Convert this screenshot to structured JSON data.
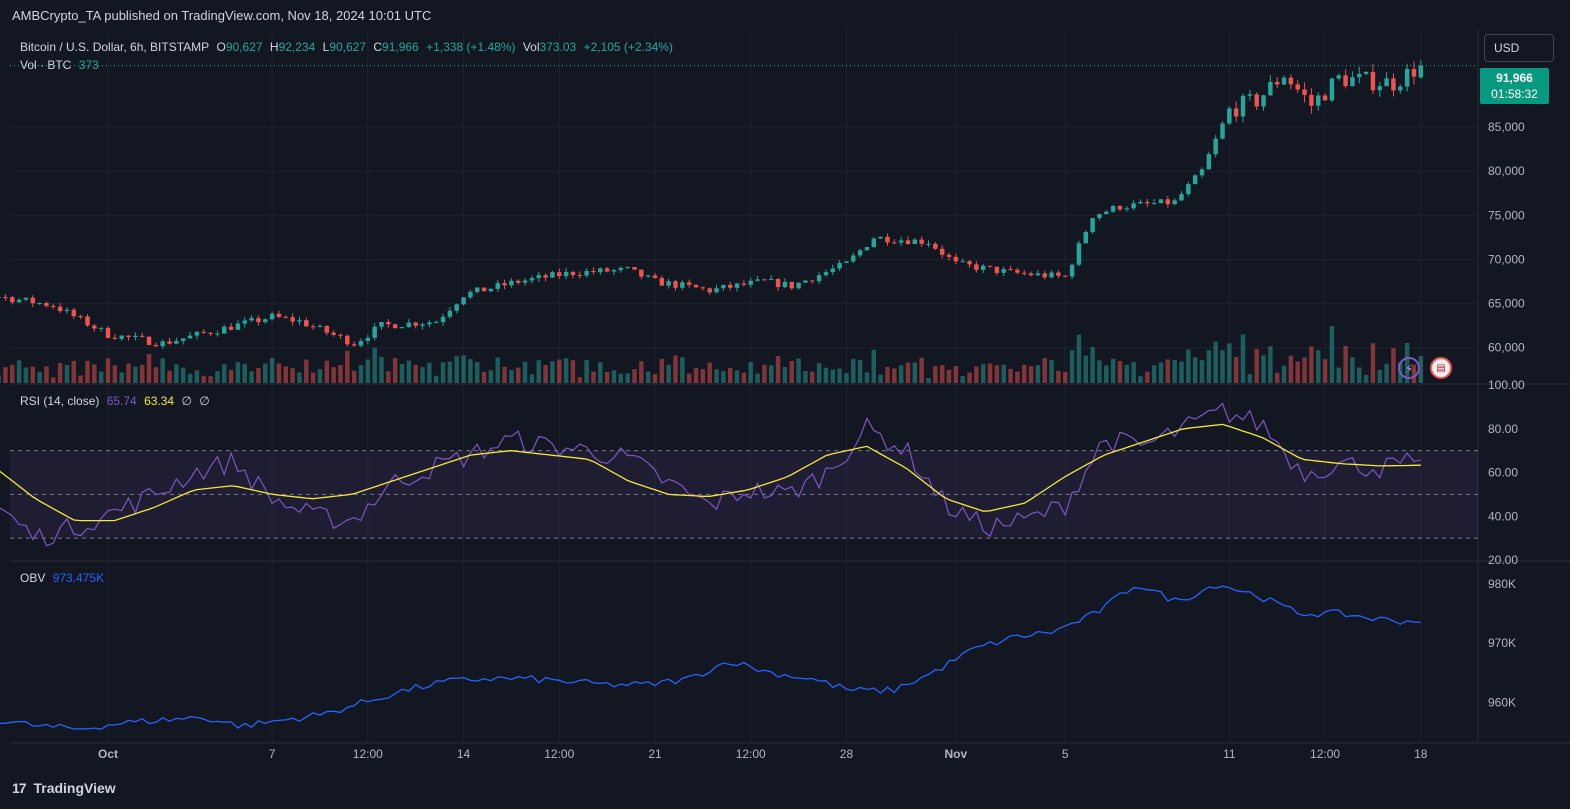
{
  "publisher": "AMBCrypto_TA published on TradingView.com, Nov 18, 2024 10:01 UTC",
  "legend": {
    "symbol": "Bitcoin / U.S. Dollar, 6h, BITSTAMP",
    "o_label": "O",
    "o": "90,627",
    "h_label": "H",
    "h": "92,234",
    "l_label": "L",
    "l": "90,627",
    "c_label": "C",
    "c": "91,966",
    "change": "+1,338 (+1.48%)",
    "vol_label": "Vol",
    "vol": "373.03",
    "vol_change": "+2,105 (+2.34%)",
    "vol_line_label": "Vol · BTC",
    "vol_line_value": "373",
    "rsi_label": "RSI (14, close)",
    "rsi_value": "65.74",
    "rsi_ma": "63.34",
    "rsi_extra1": "∅",
    "rsi_extra2": "∅",
    "obv_label": "OBV",
    "obv_value": "973.475K"
  },
  "currency_button": "USD",
  "price_tag": {
    "price": "91,966",
    "countdown": "01:58:32"
  },
  "brand": "TradingView",
  "brand_logo": "17",
  "icons": {
    "flash": "lightning-icon",
    "flag": "us-flag-icon"
  },
  "colors": {
    "up": "#26a69a",
    "down": "#ef5350",
    "rsi": "#7e57c2",
    "rsi_ma": "#f5e73c",
    "obv": "#2962ff",
    "bg": "#131722",
    "grid": "#1e222d"
  },
  "chart_data": [
    {
      "type": "candlestick",
      "title": "Bitcoin / U.S. Dollar, 6h, BITSTAMP",
      "x_ticks": [
        "Oct",
        "7",
        "12:00",
        "14",
        "12:00",
        "21",
        "12:00",
        "28",
        "Nov",
        "5",
        "11",
        "12:00",
        "18"
      ],
      "y_ticks": [
        "60,000",
        "65,000",
        "70,000",
        "75,000",
        "80,000",
        "85,000"
      ],
      "ylim": [
        56000,
        96000
      ],
      "close_path": [
        [
          "Sep 24",
          66000
        ],
        [
          "Sep 27",
          65800
        ],
        [
          "Sep 29",
          64800
        ],
        [
          "Oct 1",
          61500
        ],
        [
          "Oct 3",
          60500
        ],
        [
          "Oct 5",
          62000
        ],
        [
          "Oct 7",
          63500
        ],
        [
          "Oct 8",
          63000
        ],
        [
          "Oct 10",
          60500
        ],
        [
          "Oct 11",
          62500
        ],
        [
          "Oct 13",
          63000
        ],
        [
          "Oct 14",
          66000
        ],
        [
          "Oct 16",
          67500
        ],
        [
          "Oct 18",
          68500
        ],
        [
          "Oct 20",
          68800
        ],
        [
          "Oct 21",
          67500
        ],
        [
          "Oct 23",
          66500
        ],
        [
          "Oct 25",
          67500
        ],
        [
          "Oct 26",
          67000
        ],
        [
          "Oct 28",
          69500
        ],
        [
          "Oct 29",
          72500
        ],
        [
          "Oct 31",
          72000
        ],
        [
          "Nov 1",
          69500
        ],
        [
          "Nov 3",
          68500
        ],
        [
          "Nov 5",
          68000
        ],
        [
          "Nov 6",
          75000
        ],
        [
          "Nov 7",
          76000
        ],
        [
          "Nov 9",
          76500
        ],
        [
          "Nov 10",
          80000
        ],
        [
          "Nov 11",
          87000
        ],
        [
          "Nov 12",
          88000
        ],
        [
          "Nov 13",
          91000
        ],
        [
          "Nov 14",
          87500
        ],
        [
          "Nov 15",
          90500
        ],
        [
          "Nov 17",
          90000
        ],
        [
          "Nov 18",
          91966
        ]
      ],
      "last": {
        "open": 90627,
        "high": 92234,
        "low": 90627,
        "close": 91966
      }
    },
    {
      "type": "line",
      "title": "RSI (14, close)",
      "y_ticks": [
        "20.00",
        "40.00",
        "60.00",
        "80.00",
        "100.00"
      ],
      "ylim": [
        20,
        100
      ],
      "bands": [
        30,
        50,
        70
      ],
      "series": [
        {
          "name": "RSI",
          "values": [
            72,
            65,
            45,
            30,
            35,
            42,
            50,
            60,
            65,
            48,
            40,
            38,
            55,
            62,
            68,
            75,
            72,
            70,
            66,
            55,
            45,
            52,
            50,
            60,
            80,
            70,
            45,
            35,
            38,
            45,
            75,
            72,
            80,
            88,
            82,
            60,
            64,
            62,
            65.74
          ]
        },
        {
          "name": "MA",
          "values": [
            65,
            66,
            62,
            48,
            38,
            38,
            44,
            52,
            54,
            50,
            48,
            50,
            56,
            62,
            68,
            70,
            68,
            66,
            56,
            50,
            49,
            52,
            58,
            68,
            72,
            62,
            48,
            42,
            46,
            58,
            68,
            74,
            80,
            82,
            76,
            66,
            64,
            63,
            63.34
          ]
        }
      ]
    },
    {
      "type": "line",
      "title": "OBV",
      "y_ticks": [
        "960K",
        "970K",
        "980K"
      ],
      "ylim": [
        955,
        982
      ],
      "series": [
        {
          "name": "OBV",
          "values": [
            960,
            959.5,
            957,
            956,
            955.5,
            956.5,
            957,
            957.5,
            956,
            957,
            958,
            960,
            962,
            963.5,
            964,
            964,
            963.5,
            963,
            963,
            964,
            967,
            965,
            964,
            962,
            962,
            965,
            969,
            971,
            972,
            975,
            980,
            977,
            980,
            978,
            975,
            975,
            974,
            973.475
          ]
        }
      ]
    }
  ]
}
